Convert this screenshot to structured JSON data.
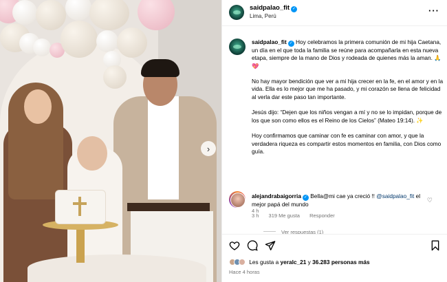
{
  "post": {
    "username": "saidpalao_fit",
    "location": "Lima, Perú",
    "caption_p1": "Hoy celebramos la primera comunión de mi hija Caetana, un día en el que toda la familia se reúne para acompañarla en esta nueva etapa, siempre de la mano de Dios y rodeada de quienes más la aman. 🙏💖",
    "caption_p2": "No hay mayor bendición que ver a mi hija crecer en la fe, en el amor y en la vida. Ella es lo mejor que me ha pasado, y mi corazón se llena de felicidad al verla dar este paso tan importante.",
    "caption_p3": "Jesús dijo: “Dejen que los niños vengan a mí y no se lo impidan, porque de los que son como ellos es el Reino de los Cielos” (Mateo 19:14). ✨",
    "caption_p4": "Hoy confirmamos que caminar con fe es caminar con amor, y que la verdadera riqueza es compartir estos momentos en familia, con Dios como guía.",
    "caption_time": "4 h"
  },
  "comment": {
    "username": "alejandrabaigorria",
    "text_before": "Bella@mi cae ya creció !! ",
    "mention": "@saidpalao_fit",
    "text_after": " el mejor papá del mundo",
    "time": "3 h",
    "likes": "319 Me gusta",
    "reply": "Responder",
    "view_replies": "Ver respuestas (1)"
  },
  "footer": {
    "likes_prefix": "Les gusta a ",
    "likes_user": "yeralc_21",
    "likes_mid": " y ",
    "likes_count": "36.283 personas más",
    "posted_ago": "Hace 4 horas"
  },
  "icons": {
    "more": "more-options-icon",
    "like": "heart-icon",
    "comment": "comment-icon",
    "share": "share-icon",
    "save": "bookmark-icon",
    "next": "chevron-right-icon"
  },
  "colors": {
    "verified": "#0095f6",
    "meta_text": "#737373",
    "mention": "#00376b"
  }
}
